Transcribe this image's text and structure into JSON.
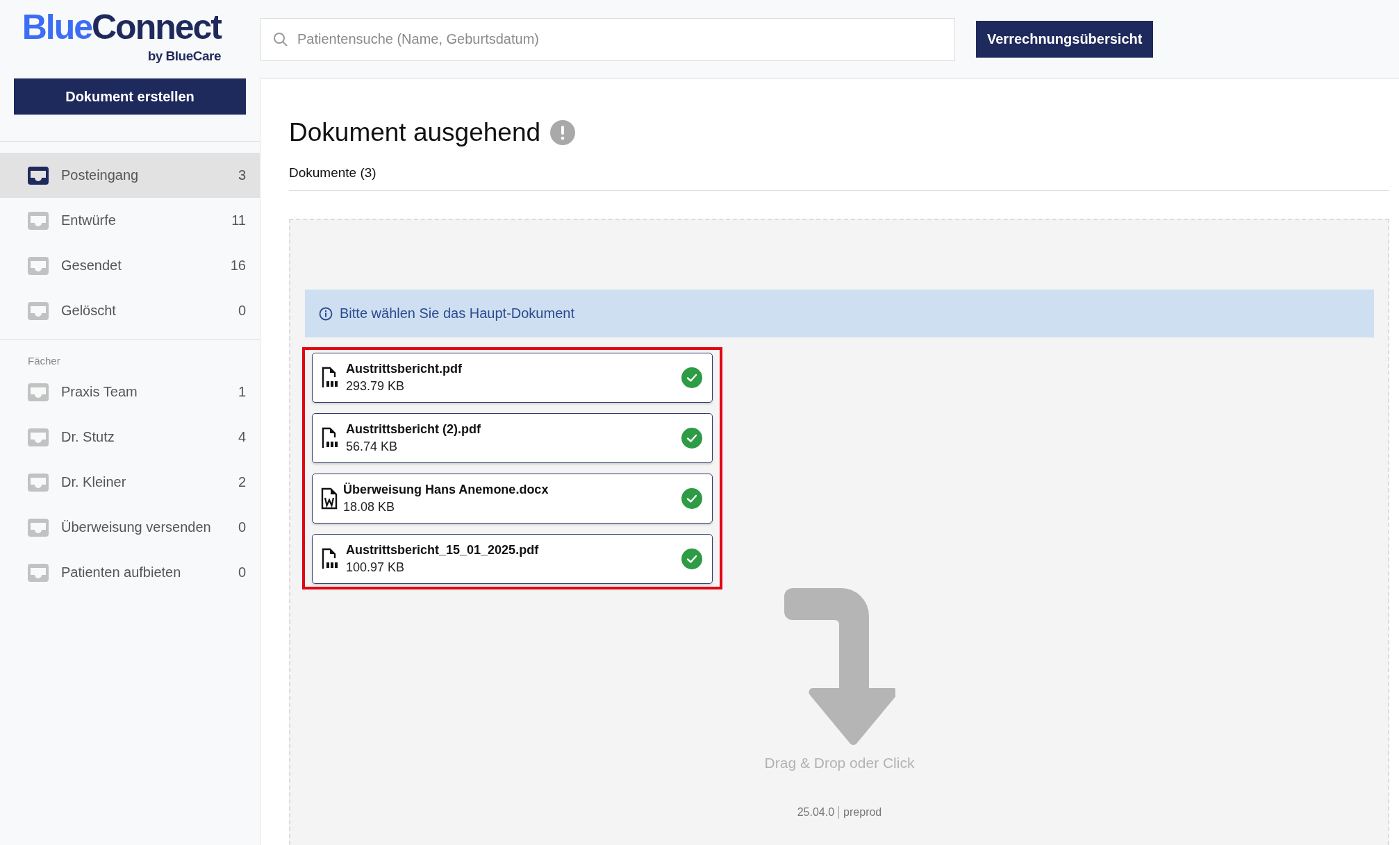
{
  "logo": {
    "name_parts": [
      "Blue",
      "Connect"
    ],
    "tagline": "by BlueCare"
  },
  "search": {
    "placeholder": "Patientensuche (Name, Geburtsdatum)"
  },
  "header_button": "Verrechnungsübersicht",
  "create_button": "Dokument erstellen",
  "mailboxes": [
    {
      "label": "Posteingang",
      "count": "3",
      "selected": true
    },
    {
      "label": "Entwürfe",
      "count": "11",
      "selected": false
    },
    {
      "label": "Gesendet",
      "count": "16",
      "selected": false
    },
    {
      "label": "Gelöscht",
      "count": "0",
      "selected": false
    }
  ],
  "folders": {
    "heading": "Fächer",
    "items": [
      {
        "label": "Praxis Team",
        "count": "1",
        "selected": false
      },
      {
        "label": "Dr. Stutz",
        "count": "4",
        "selected": false
      },
      {
        "label": "Dr. Kleiner",
        "count": "2",
        "selected": false
      },
      {
        "label": "Überweisung versenden",
        "count": "0",
        "selected": false
      },
      {
        "label": "Patienten aufbieten",
        "count": "0",
        "selected": false
      }
    ]
  },
  "page_title": "Dokument ausgehend",
  "documents_tab": "Dokumente (3)",
  "info_banner": "Bitte wählen Sie das Haupt-Dokument",
  "files_highlighted": true,
  "files": [
    {
      "kind": "pdf",
      "name": "Austrittsbericht.pdf",
      "size": "293.79 KB",
      "checked": true
    },
    {
      "kind": "pdf",
      "name": "Austrittsbericht (2).pdf",
      "size": "56.74 KB",
      "checked": true
    },
    {
      "kind": "docx",
      "name": "Überweisung Hans Anemone.docx",
      "size": "18.08 KB",
      "checked": true
    },
    {
      "kind": "pdf",
      "name": "Austrittsbericht_15_01_2025.pdf",
      "size": "100.97 KB",
      "checked": true
    }
  ],
  "drop_hint": "Drag & Drop oder Click",
  "footer": {
    "version": "25.04.0",
    "environment": "preprod"
  }
}
